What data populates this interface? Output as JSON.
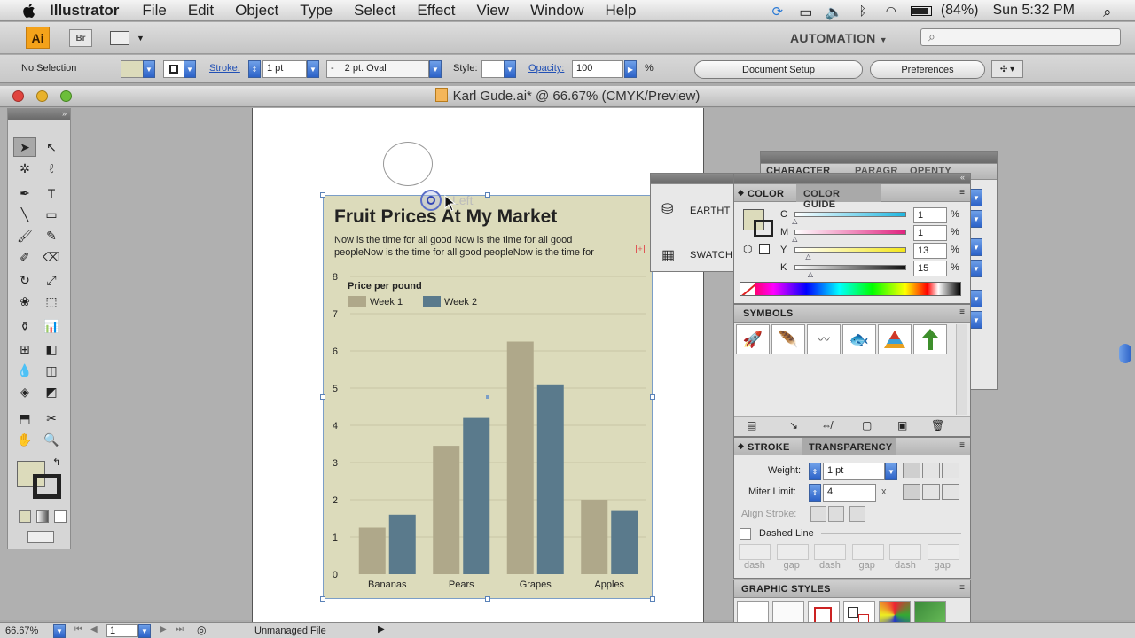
{
  "menubar": {
    "app_name": "Illustrator",
    "items": [
      "File",
      "Edit",
      "Object",
      "Type",
      "Select",
      "Effect",
      "View",
      "Window",
      "Help"
    ],
    "battery": "(84%)",
    "clock": "Sun 5:32 PM"
  },
  "appbar": {
    "logo": "Ai",
    "bridge": "Br",
    "workspace": "AUTOMATION"
  },
  "controlbar": {
    "selection": "No Selection",
    "stroke_label": "Stroke:",
    "stroke_weight": "1 pt",
    "brush": "2 pt. Oval",
    "brush_dash": "-",
    "style_label": "Style:",
    "opacity_label": "Opacity:",
    "opacity_value": "100",
    "percent": "%",
    "document_setup": "Document Setup",
    "preferences": "Preferences"
  },
  "document": {
    "title": "Karl Gude.ai* @ 66.67% (CMYK/Preview)"
  },
  "artwork": {
    "cursor_label": "Left",
    "title": "Fruit Prices At My Market",
    "body_line1": "Now is the time for all good Now is the time for all good",
    "body_line2": "peopleNow is the time for all good peopleNow is the time for"
  },
  "chart_data": {
    "type": "bar",
    "title": "Price per pound",
    "categories": [
      "Bananas",
      "Pears",
      "Grapes",
      "Apples"
    ],
    "series": [
      {
        "name": "Week 1",
        "values": [
          1.25,
          3.45,
          6.25,
          2.0
        ],
        "color": "#afa88a"
      },
      {
        "name": "Week 2",
        "values": [
          1.6,
          4.2,
          5.1,
          1.7
        ],
        "color": "#5a7a8c"
      }
    ],
    "yticks": [
      "0",
      "1",
      "2",
      "3",
      "4",
      "5",
      "6",
      "7",
      "8"
    ],
    "ylim": [
      0,
      8
    ],
    "grid": true,
    "legend": "top-left"
  },
  "panels": {
    "character_tabs": [
      "CHARACTER",
      "PARAGR",
      "OPENTY"
    ],
    "earth_label": "EARTHT",
    "swatch_label": "SWATCH",
    "color_tab": "COLOR",
    "color_guide_tab": "COLOR GUIDE",
    "cmyk": [
      {
        "label": "C",
        "value": "1",
        "pct": "%"
      },
      {
        "label": "M",
        "value": "1",
        "pct": "%"
      },
      {
        "label": "Y",
        "value": "13",
        "pct": "%"
      },
      {
        "label": "K",
        "value": "15",
        "pct": "%"
      }
    ],
    "symbols_tab": "SYMBOLS",
    "stroke_tab": "STROKE",
    "transparency_tab": "TRANSPARENCY",
    "weight_label": "Weight:",
    "weight_value": "1 pt",
    "miter_label": "Miter Limit:",
    "miter_value": "4",
    "miter_x": "x",
    "align_label": "Align Stroke:",
    "dashed_label": "Dashed Line",
    "dash_labels": [
      "dash",
      "gap",
      "dash",
      "gap",
      "dash",
      "gap"
    ],
    "graphic_styles_tab": "GRAPHIC STYLES"
  },
  "statusbar": {
    "zoom": "66.67%",
    "page": "1",
    "status": "Unmanaged File"
  }
}
